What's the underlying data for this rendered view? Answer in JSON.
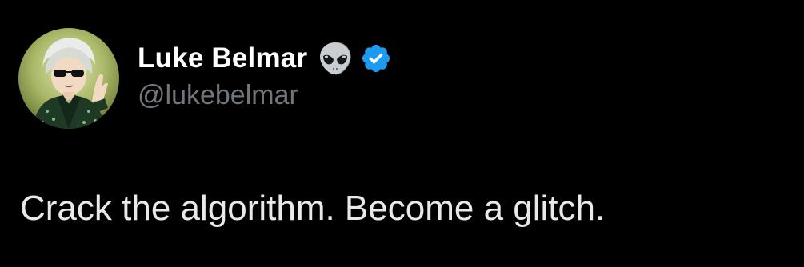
{
  "author": {
    "display_name": "Luke Belmar",
    "handle": "@lukebelmar",
    "name_emoji": "alien-icon",
    "verified_badge": "verified-badge-icon",
    "avatar": "avatar-anime-character-icon"
  },
  "tweet": {
    "text": "Crack the algorithm. Become a glitch."
  },
  "colors": {
    "background": "#000000",
    "display_name": "#ffffff",
    "handle": "#71767b",
    "tweet_text": "#e7e9ea",
    "verified": "#1d9bf0"
  }
}
